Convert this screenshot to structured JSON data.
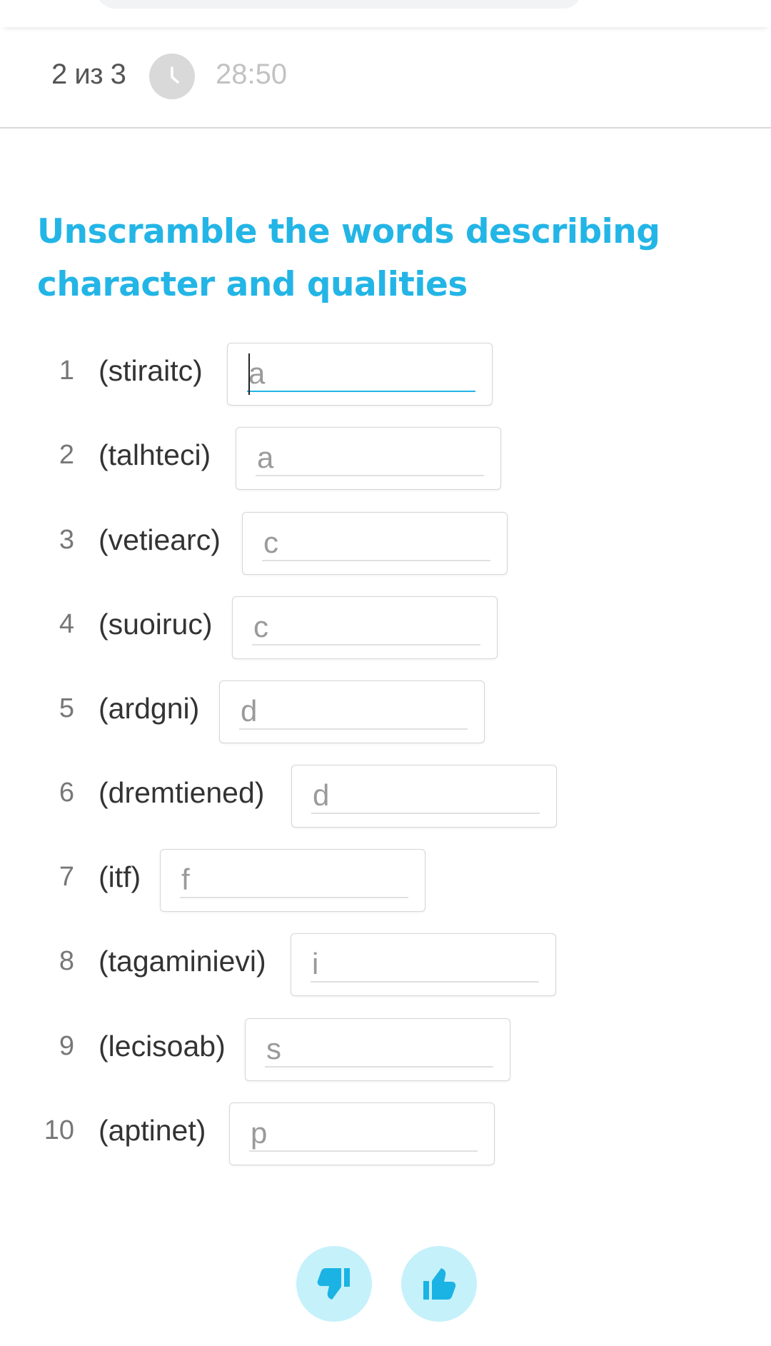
{
  "header": {
    "progress": "2 из 3",
    "timer": "28:50"
  },
  "title": "Unscramble the words describing character and qualities",
  "rows": [
    {
      "num": "1",
      "word": "(stiraitc)",
      "hint": "a",
      "value": ""
    },
    {
      "num": "2",
      "word": "(talhteci)",
      "hint": "a",
      "value": ""
    },
    {
      "num": "3",
      "word": "(vetiearc)",
      "hint": "c",
      "value": ""
    },
    {
      "num": "4",
      "word": "(suoiruc)",
      "hint": "c",
      "value": ""
    },
    {
      "num": "5",
      "word": "(ardgni)",
      "hint": "d",
      "value": ""
    },
    {
      "num": "6",
      "word": "(dremtiened)",
      "hint": "d",
      "value": ""
    },
    {
      "num": "7",
      "word": "(itf)",
      "hint": "f",
      "value": ""
    },
    {
      "num": "8",
      "word": "(tagaminievi)",
      "hint": "i",
      "value": ""
    },
    {
      "num": "9",
      "word": "(lecisoab)",
      "hint": "s",
      "value": ""
    },
    {
      "num": "10",
      "word": "(aptinet)",
      "hint": "p",
      "value": ""
    }
  ],
  "feedback": {
    "dislike_icon": "thumbs-down-icon",
    "like_icon": "thumbs-up-icon"
  },
  "colors": {
    "accent": "#23b5e6",
    "feedback_bg": "#c5f1fb",
    "feedback_icon": "#1ab3e4"
  }
}
